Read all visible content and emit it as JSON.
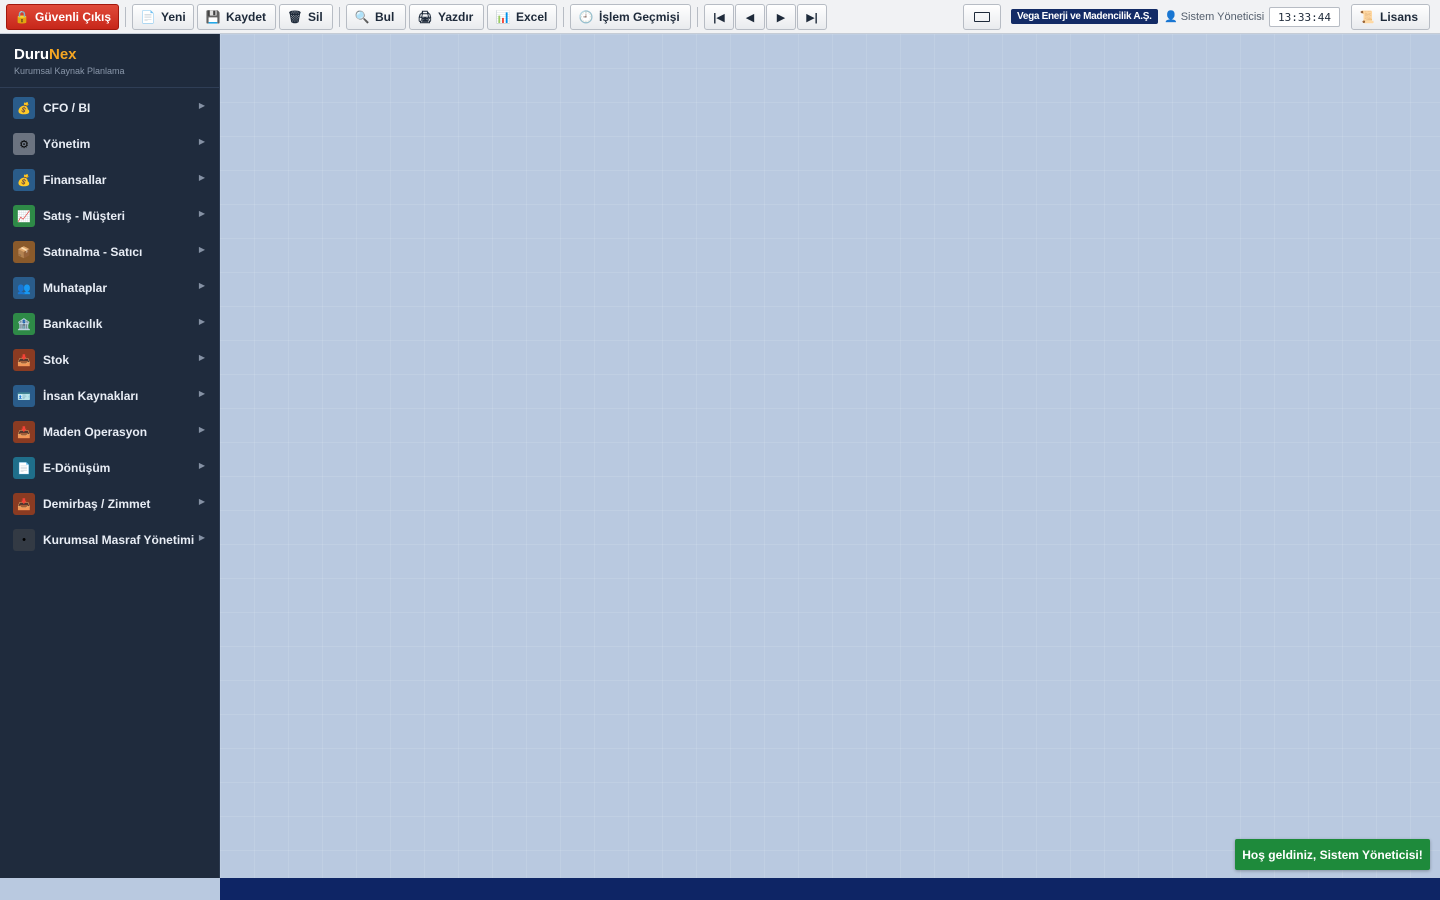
{
  "toolbar": {
    "exit_label": "Güvenli Çıkış",
    "new_label": "Yeni",
    "save_label": "Kaydet",
    "delete_label": "Sil",
    "find_label": "Bul",
    "print_label": "Yazdır",
    "excel_label": "Excel",
    "history_label": "İşlem Geçmişi",
    "nav_first": "|◀",
    "nav_prev": "◀",
    "nav_next": "▶",
    "nav_last": "▶|",
    "license_label": "Lisans"
  },
  "header": {
    "company": "Vega Enerji ve Madencilik A.Ş.",
    "user": "Sistem Yöneticisi",
    "clock": "13:33:44"
  },
  "brand": {
    "name_part1": "Duru",
    "name_part2": "Nex",
    "subtitle": "Kurumsal Kaynak Planlama"
  },
  "sidebar": {
    "items": [
      {
        "label": "CFO / BI",
        "icon": "money-bag-icon",
        "icon_glyph": "💰",
        "color": "#2a5c8a"
      },
      {
        "label": "Yönetim",
        "icon": "gear-icon",
        "icon_glyph": "⚙",
        "color": "#6b7380"
      },
      {
        "label": "Finansallar",
        "icon": "money-bag-icon",
        "icon_glyph": "💰",
        "color": "#2a5c8a"
      },
      {
        "label": "Satış - Müşteri",
        "icon": "chart-up-icon",
        "icon_glyph": "📈",
        "color": "#2e8a47"
      },
      {
        "label": "Satınalma - Satıcı",
        "icon": "package-icon",
        "icon_glyph": "📦",
        "color": "#8a5a2b"
      },
      {
        "label": "Muhataplar",
        "icon": "people-icon",
        "icon_glyph": "👥",
        "color": "#2a5c8a"
      },
      {
        "label": "Bankacılık",
        "icon": "bank-icon",
        "icon_glyph": "🏦",
        "color": "#2e8a47"
      },
      {
        "label": "Stok",
        "icon": "boxes-icon",
        "icon_glyph": "📥",
        "color": "#8a3b22"
      },
      {
        "label": "İnsan Kaynakları",
        "icon": "id-card-icon",
        "icon_glyph": "🪪",
        "color": "#2a5c8a"
      },
      {
        "label": "Maden Operasyon",
        "icon": "boxes-icon",
        "icon_glyph": "📥",
        "color": "#8a3b22"
      },
      {
        "label": "E-Dönüşüm",
        "icon": "document-icon",
        "icon_glyph": "📄",
        "color": "#1f6e8a"
      },
      {
        "label": "Demirbaş / Zimmet",
        "icon": "boxes-icon",
        "icon_glyph": "📥",
        "color": "#8a3b22"
      },
      {
        "label": "Kurumsal Masraf Yönetimi",
        "icon": "dot-icon",
        "icon_glyph": "•",
        "color": "#333a44"
      }
    ]
  },
  "toast": {
    "message": "Hoş geldiniz, Sistem Yöneticisi!"
  },
  "colors": {
    "workspace_bg": "#b9c9e0",
    "sidebar_bg": "#1f2b3d",
    "exit_red": "#d0342a",
    "footer_navy": "#0e2565",
    "toast_green": "#1e8a3b",
    "brand_accent": "#f5a623"
  }
}
